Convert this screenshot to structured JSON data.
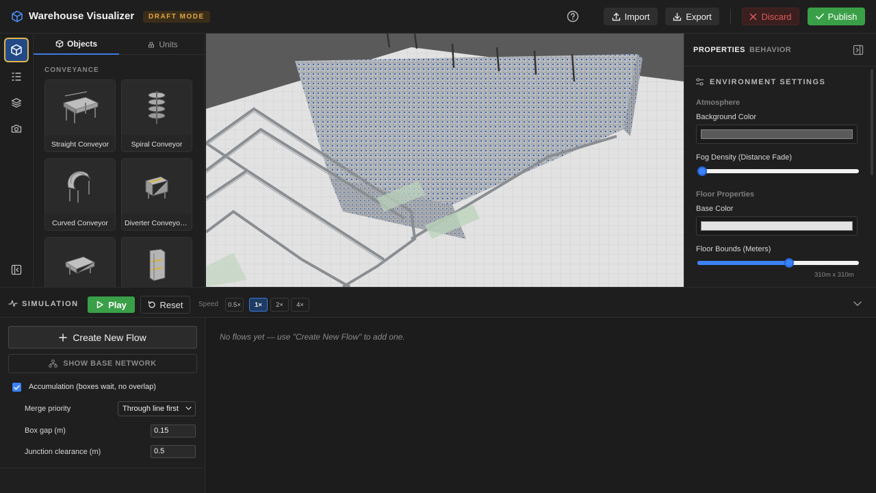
{
  "header": {
    "title": "Warehouse Visualizer",
    "badge": "DRAFT MODE",
    "import_label": "Import",
    "export_label": "Export",
    "discard_label": "Discard",
    "publish_label": "Publish",
    "icons": [
      "cube-icon",
      "help-icon",
      "upload-icon",
      "download-icon",
      "x-icon",
      "check-icon"
    ]
  },
  "rail": {
    "icons": [
      "cube-icon",
      "list-tree-icon",
      "layers-icon",
      "camera-icon",
      "collapse-left-icon"
    ]
  },
  "objects_panel": {
    "tabs": [
      {
        "label": "Objects",
        "active": true
      },
      {
        "label": "Units",
        "active": false
      }
    ],
    "section": "CONVEYANCE",
    "items": [
      {
        "label": "Straight Conveyor"
      },
      {
        "label": "Spiral Conveyor"
      },
      {
        "label": "Curved Conveyor"
      },
      {
        "label": "Diverter Conveyor ..."
      },
      {
        "label": ""
      },
      {
        "label": ""
      }
    ]
  },
  "properties": {
    "tabs": [
      {
        "label": "PROPERTIES",
        "active": true
      },
      {
        "label": "BEHAVIOR",
        "active": false
      }
    ],
    "section": "ENVIRONMENT SETTINGS",
    "atmosphere": {
      "group": "Atmosphere",
      "background_color_label": "Background Color",
      "background_color": "#5a5a5a",
      "fog_label": "Fog Density (Distance Fade)",
      "fog_value": 0.0
    },
    "floor": {
      "group": "Floor Properties",
      "base_color_label": "Base Color",
      "base_color": "#e4e4e4",
      "bounds_label": "Floor Bounds (Meters)",
      "bounds_fraction": 0.57,
      "bounds_value": "310m x 310m"
    }
  },
  "simulation": {
    "title": "SIMULATION",
    "play_label": "Play",
    "reset_label": "Reset",
    "speed_label": "Speed",
    "speeds": [
      {
        "label": "0.5×",
        "active": false
      },
      {
        "label": "1×",
        "active": true
      },
      {
        "label": "2×",
        "active": false
      },
      {
        "label": "4×",
        "active": false
      }
    ]
  },
  "flows": {
    "create_label": "Create New Flow",
    "network_label": "SHOW BASE NETWORK",
    "accumulation_label": "Accumulation (boxes wait, no overlap)",
    "accumulation_checked": true,
    "merge_priority_label": "Merge priority",
    "merge_priority_value": "Through line first",
    "box_gap_label": "Box gap (m)",
    "box_gap_value": "0.15",
    "junction_label": "Junction clearance (m)",
    "junction_value": "0.5",
    "empty_message": "No flows yet — use \"Create New Flow\" to add one."
  },
  "colors": {
    "accent": "#3b82f6",
    "publish": "#3aa048",
    "discard": "#e05a5a",
    "badge": "#e0a640"
  }
}
